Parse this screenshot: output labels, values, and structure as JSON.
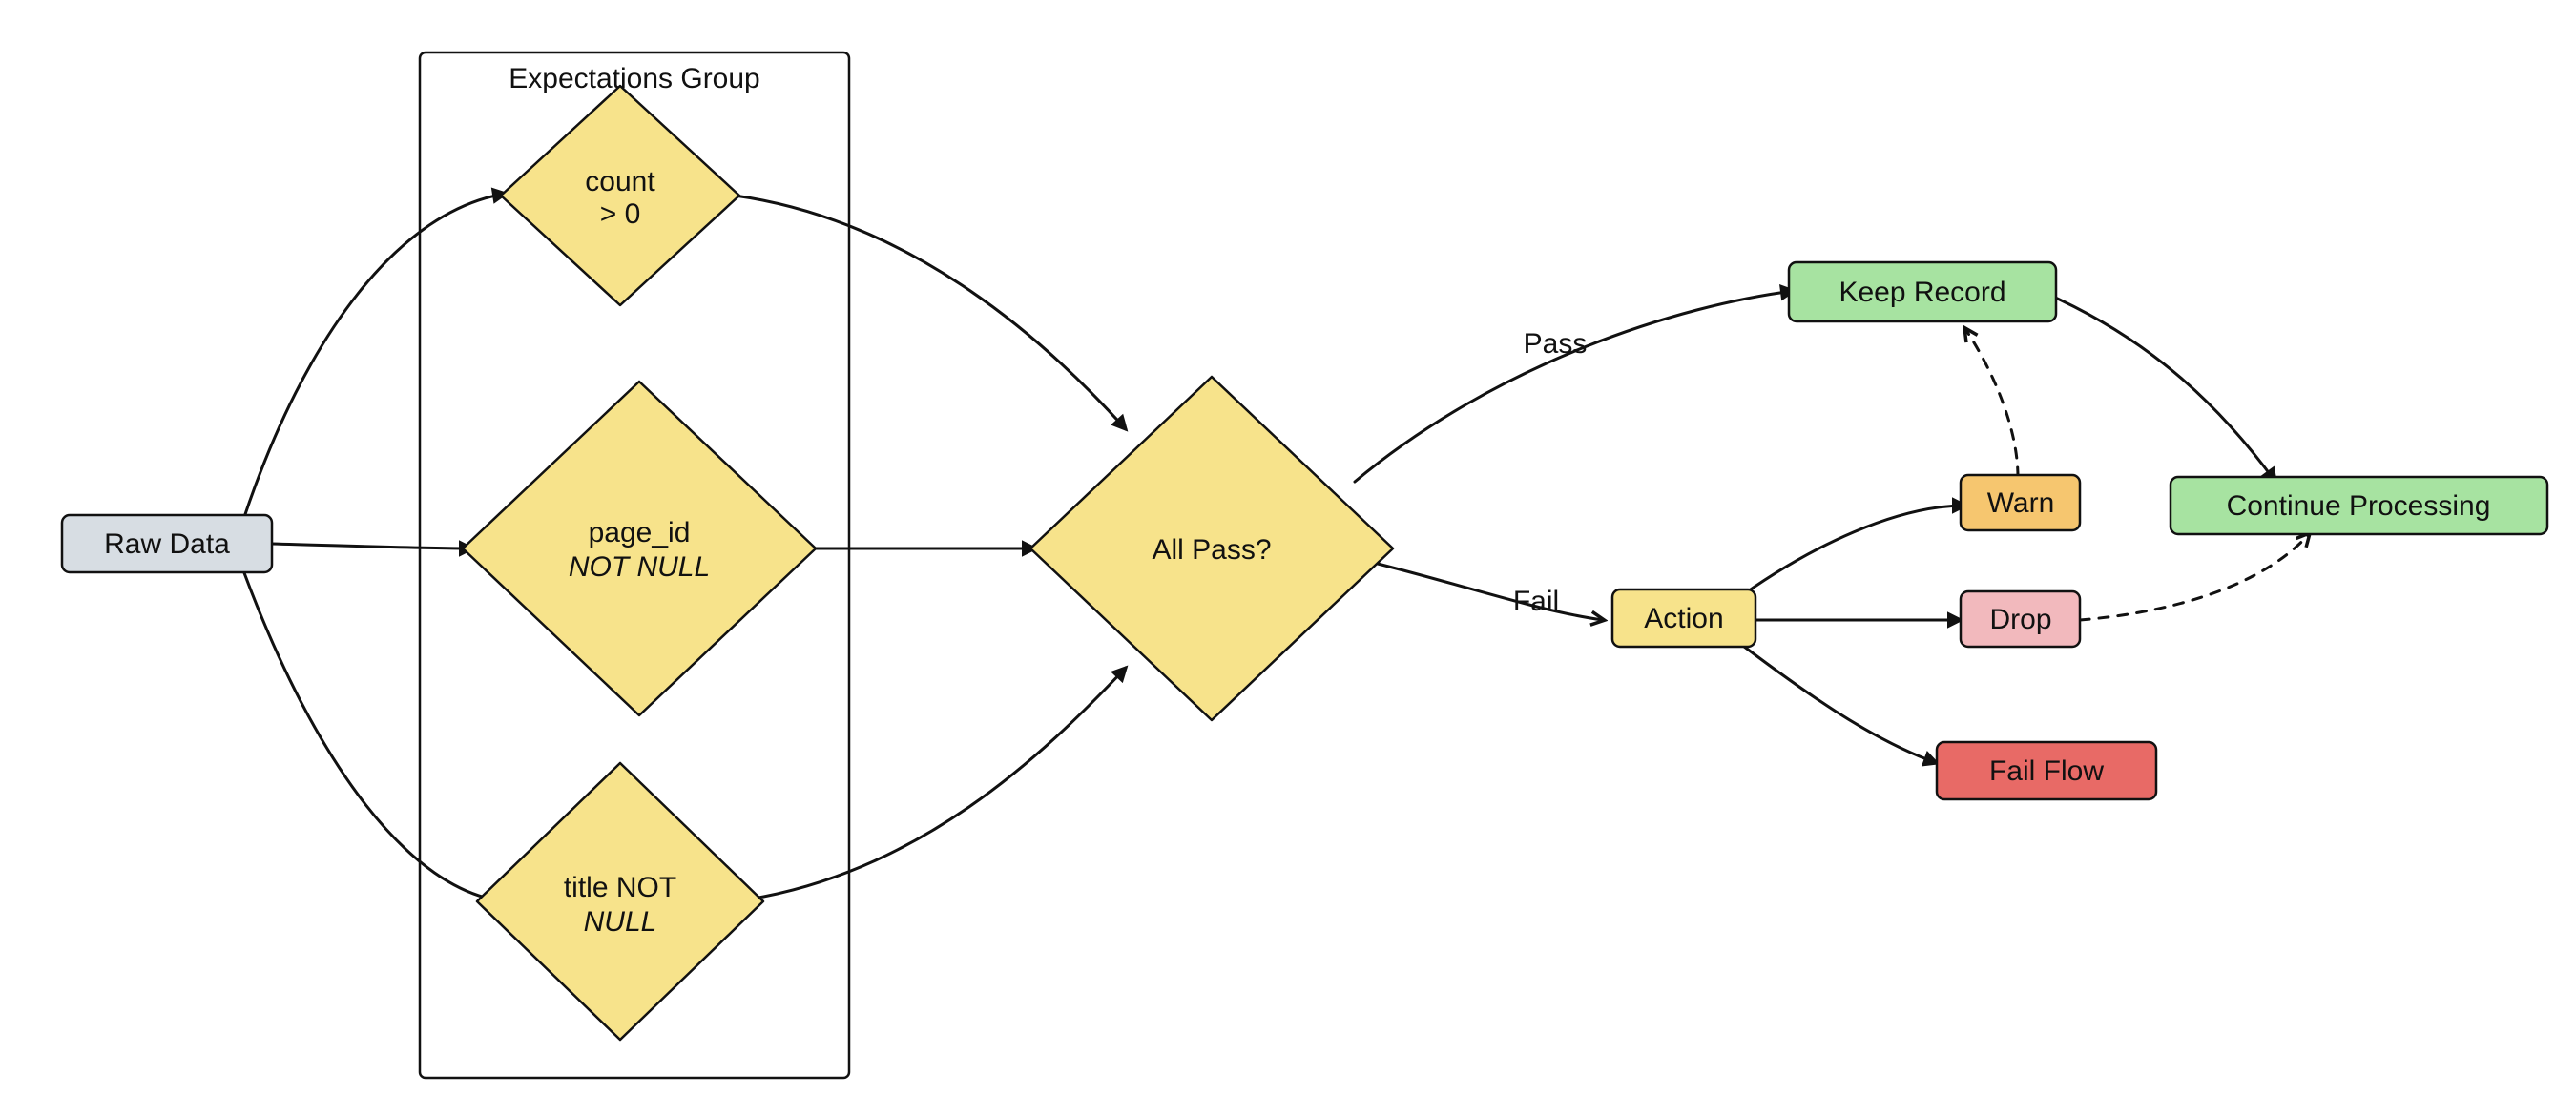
{
  "nodes": {
    "raw_data": {
      "label": "Raw Data"
    },
    "expectations_group": {
      "label": "Expectations Group"
    },
    "exp_count": {
      "line1": "count",
      "line2": "> 0"
    },
    "exp_page_id": {
      "line1": "page_id",
      "line2": "NOT NULL"
    },
    "exp_title": {
      "line1": "title NOT",
      "line2": "NULL"
    },
    "all_pass": {
      "label": "All Pass?"
    },
    "keep_record": {
      "label": "Keep Record"
    },
    "action": {
      "label": "Action"
    },
    "warn": {
      "label": "Warn"
    },
    "drop": {
      "label": "Drop"
    },
    "fail_flow": {
      "label": "Fail Flow"
    },
    "continue_processing": {
      "label": "Continue Processing"
    }
  },
  "edges": {
    "pass": {
      "label": "Pass"
    },
    "fail": {
      "label": "Fail"
    }
  },
  "colors": {
    "gray": "#d7dde3",
    "yellow": "#f7e38b",
    "green": "#a7e3a1",
    "orange": "#f6c66f",
    "pink": "#f2b9bd",
    "red": "#e86a66"
  }
}
